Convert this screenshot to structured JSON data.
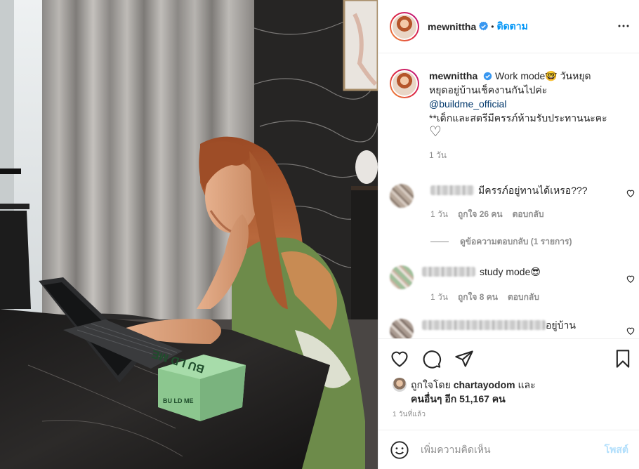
{
  "post": {
    "username": "mewnittha",
    "separator": "•",
    "follow_label": "ติดตาม",
    "caption_line1": "Work mode🤓 วันหยุด",
    "caption_line2": "หยุดอยู่บ้านเช็คงานกันไปค่ะ",
    "caption_mention": "@buildme_official",
    "caption_line4": "**เด็กและสตรีมีครรภ์ห้ามรับประทานนะคะ",
    "caption_heart": "♡",
    "caption_time": "1 วัน"
  },
  "comments": [
    {
      "text": "มีครรภ์อยู่ทานได้เหรอ???",
      "time": "1 วัน",
      "likes": "ถูกใจ 26 คน",
      "reply": "ตอบกลับ"
    },
    {
      "text": "study mode😎",
      "time": "1 วัน",
      "likes": "ถูกใจ 8 คน",
      "reply": "ตอบกลับ"
    },
    {
      "text": "อยู่บ้าน"
    }
  ],
  "view_replies": "ดูข้อความตอบกลับ (1 รายการ)",
  "likes": {
    "prefix": "ถูกใจโดย",
    "user": "chartayodom",
    "joiner": "และ",
    "others": "คนอื่นๆ อีก 51,167 คน"
  },
  "posted_ago": "1 วันที่แล้ว",
  "add_comment": {
    "placeholder": "เพิ่มความคิดเห็น",
    "post_label": "โพสต์"
  },
  "photo_text": {
    "box_front": "BU LD ME",
    "box_top": "BU LD ME"
  },
  "icons": {
    "verified": "verified-badge-icon",
    "more": "more-horizontal-icon",
    "like": "heart-icon",
    "comment": "comment-bubble-icon",
    "share": "paper-plane-icon",
    "save": "bookmark-icon",
    "emoji": "emoji-smile-icon"
  },
  "colors": {
    "link_blue": "#0095f6",
    "mention": "#00376b",
    "muted": "#8e8e8e",
    "post_disabled": "#b2dffc"
  }
}
